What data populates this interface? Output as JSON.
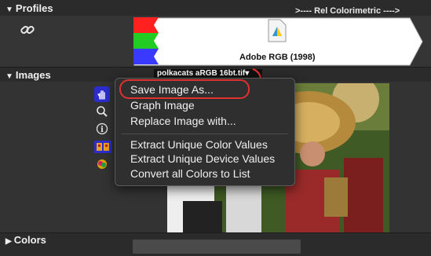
{
  "profiles": {
    "title": "Profiles",
    "intent_label": ">---- Rel Colorimetric ---->",
    "profile_name": "Adobe RGB (1998)",
    "channel_colors": [
      "#ff2020",
      "#22cc22",
      "#3a3aff"
    ]
  },
  "images": {
    "title": "Images",
    "filename": "polkacats aRGB 16bt.tif▾",
    "tool_icons": [
      "hand-icon",
      "magnifier-icon",
      "info-icon",
      "swatch-icon",
      "color-wheel-icon"
    ]
  },
  "context_menu": {
    "items": [
      {
        "label": "Save Image As..."
      },
      {
        "label": "Graph Image"
      },
      {
        "label": "Replace Image with..."
      }
    ],
    "items2": [
      {
        "label": "Extract Unique Color Values"
      },
      {
        "label": "Extract Unique Device Values"
      },
      {
        "label": "Convert all Colors to List"
      }
    ],
    "highlight_color": "#e03030"
  },
  "colors": {
    "title": "Colors"
  }
}
